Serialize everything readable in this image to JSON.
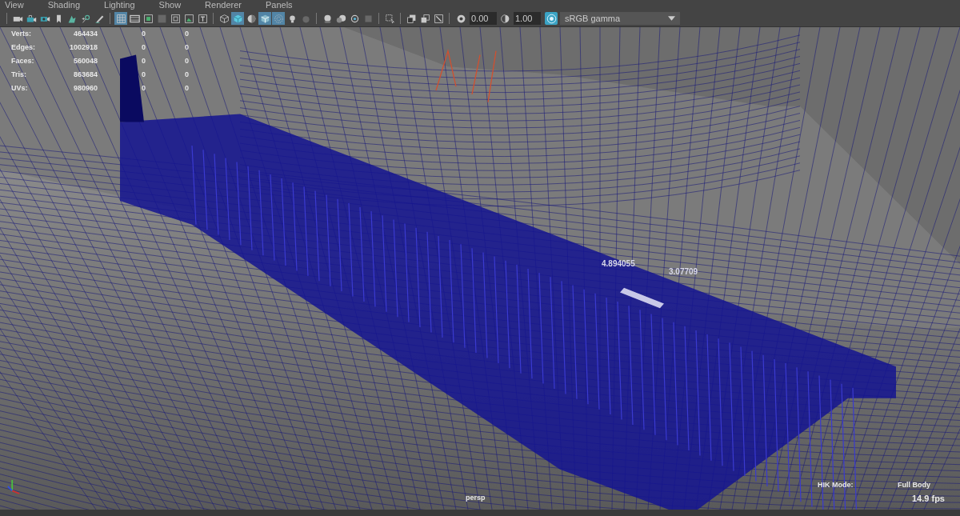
{
  "menu_bar": {
    "items": [
      "View",
      "Shading",
      "Lighting",
      "Show",
      "Renderer",
      "Panels"
    ]
  },
  "toolbar": {
    "groups": [
      {
        "buttons": [
          {
            "on": false
          },
          {
            "on": false
          },
          {
            "on": false
          },
          {
            "on": false
          },
          {
            "on": false
          },
          {
            "on": false
          },
          {
            "on": false
          }
        ]
      },
      {
        "buttons": [
          {
            "on": true
          },
          {
            "on": false
          },
          {
            "on": false
          },
          {
            "on": false
          },
          {
            "on": false
          },
          {
            "on": false
          },
          {
            "on": false
          }
        ]
      },
      {
        "buttons": [
          {
            "on": false
          },
          {
            "on": true
          },
          {
            "on": false
          },
          {
            "on": true
          },
          {
            "on": true
          },
          {
            "on": false
          },
          {
            "on": false
          }
        ]
      },
      {
        "buttons": [
          {
            "on": false
          },
          {
            "on": false
          },
          {
            "on": false
          },
          {
            "on": false
          }
        ]
      },
      {
        "buttons": [
          {
            "on": false
          }
        ]
      },
      {
        "buttons": [
          {
            "on": false
          },
          {
            "on": false
          },
          {
            "on": false
          }
        ]
      }
    ],
    "exposure": "0.00",
    "gamma": "1.00",
    "color_management": {
      "on": true
    },
    "view_transform": "sRGB gamma"
  },
  "viewport": {
    "stats": [
      {
        "label": "Verts:",
        "value": "464434",
        "column_3": "0",
        "column_4": "0"
      },
      {
        "label": "Edges:",
        "value": "1002918",
        "column_3": "0",
        "column_4": "0"
      },
      {
        "label": "Faces:",
        "value": "560048",
        "column_3": "0",
        "column_4": "0"
      },
      {
        "label": "Tris:",
        "value": "863684",
        "column_3": "0",
        "column_4": "0"
      },
      {
        "label": "UVs:",
        "value": "980960",
        "column_3": "0",
        "column_4": "0"
      }
    ],
    "measurements": [
      "4.894055",
      "3.07709"
    ],
    "camera": "persp",
    "hik_label": "HIK Mode:",
    "hik_value": "Full Body",
    "fps": "14.9 fps"
  }
}
